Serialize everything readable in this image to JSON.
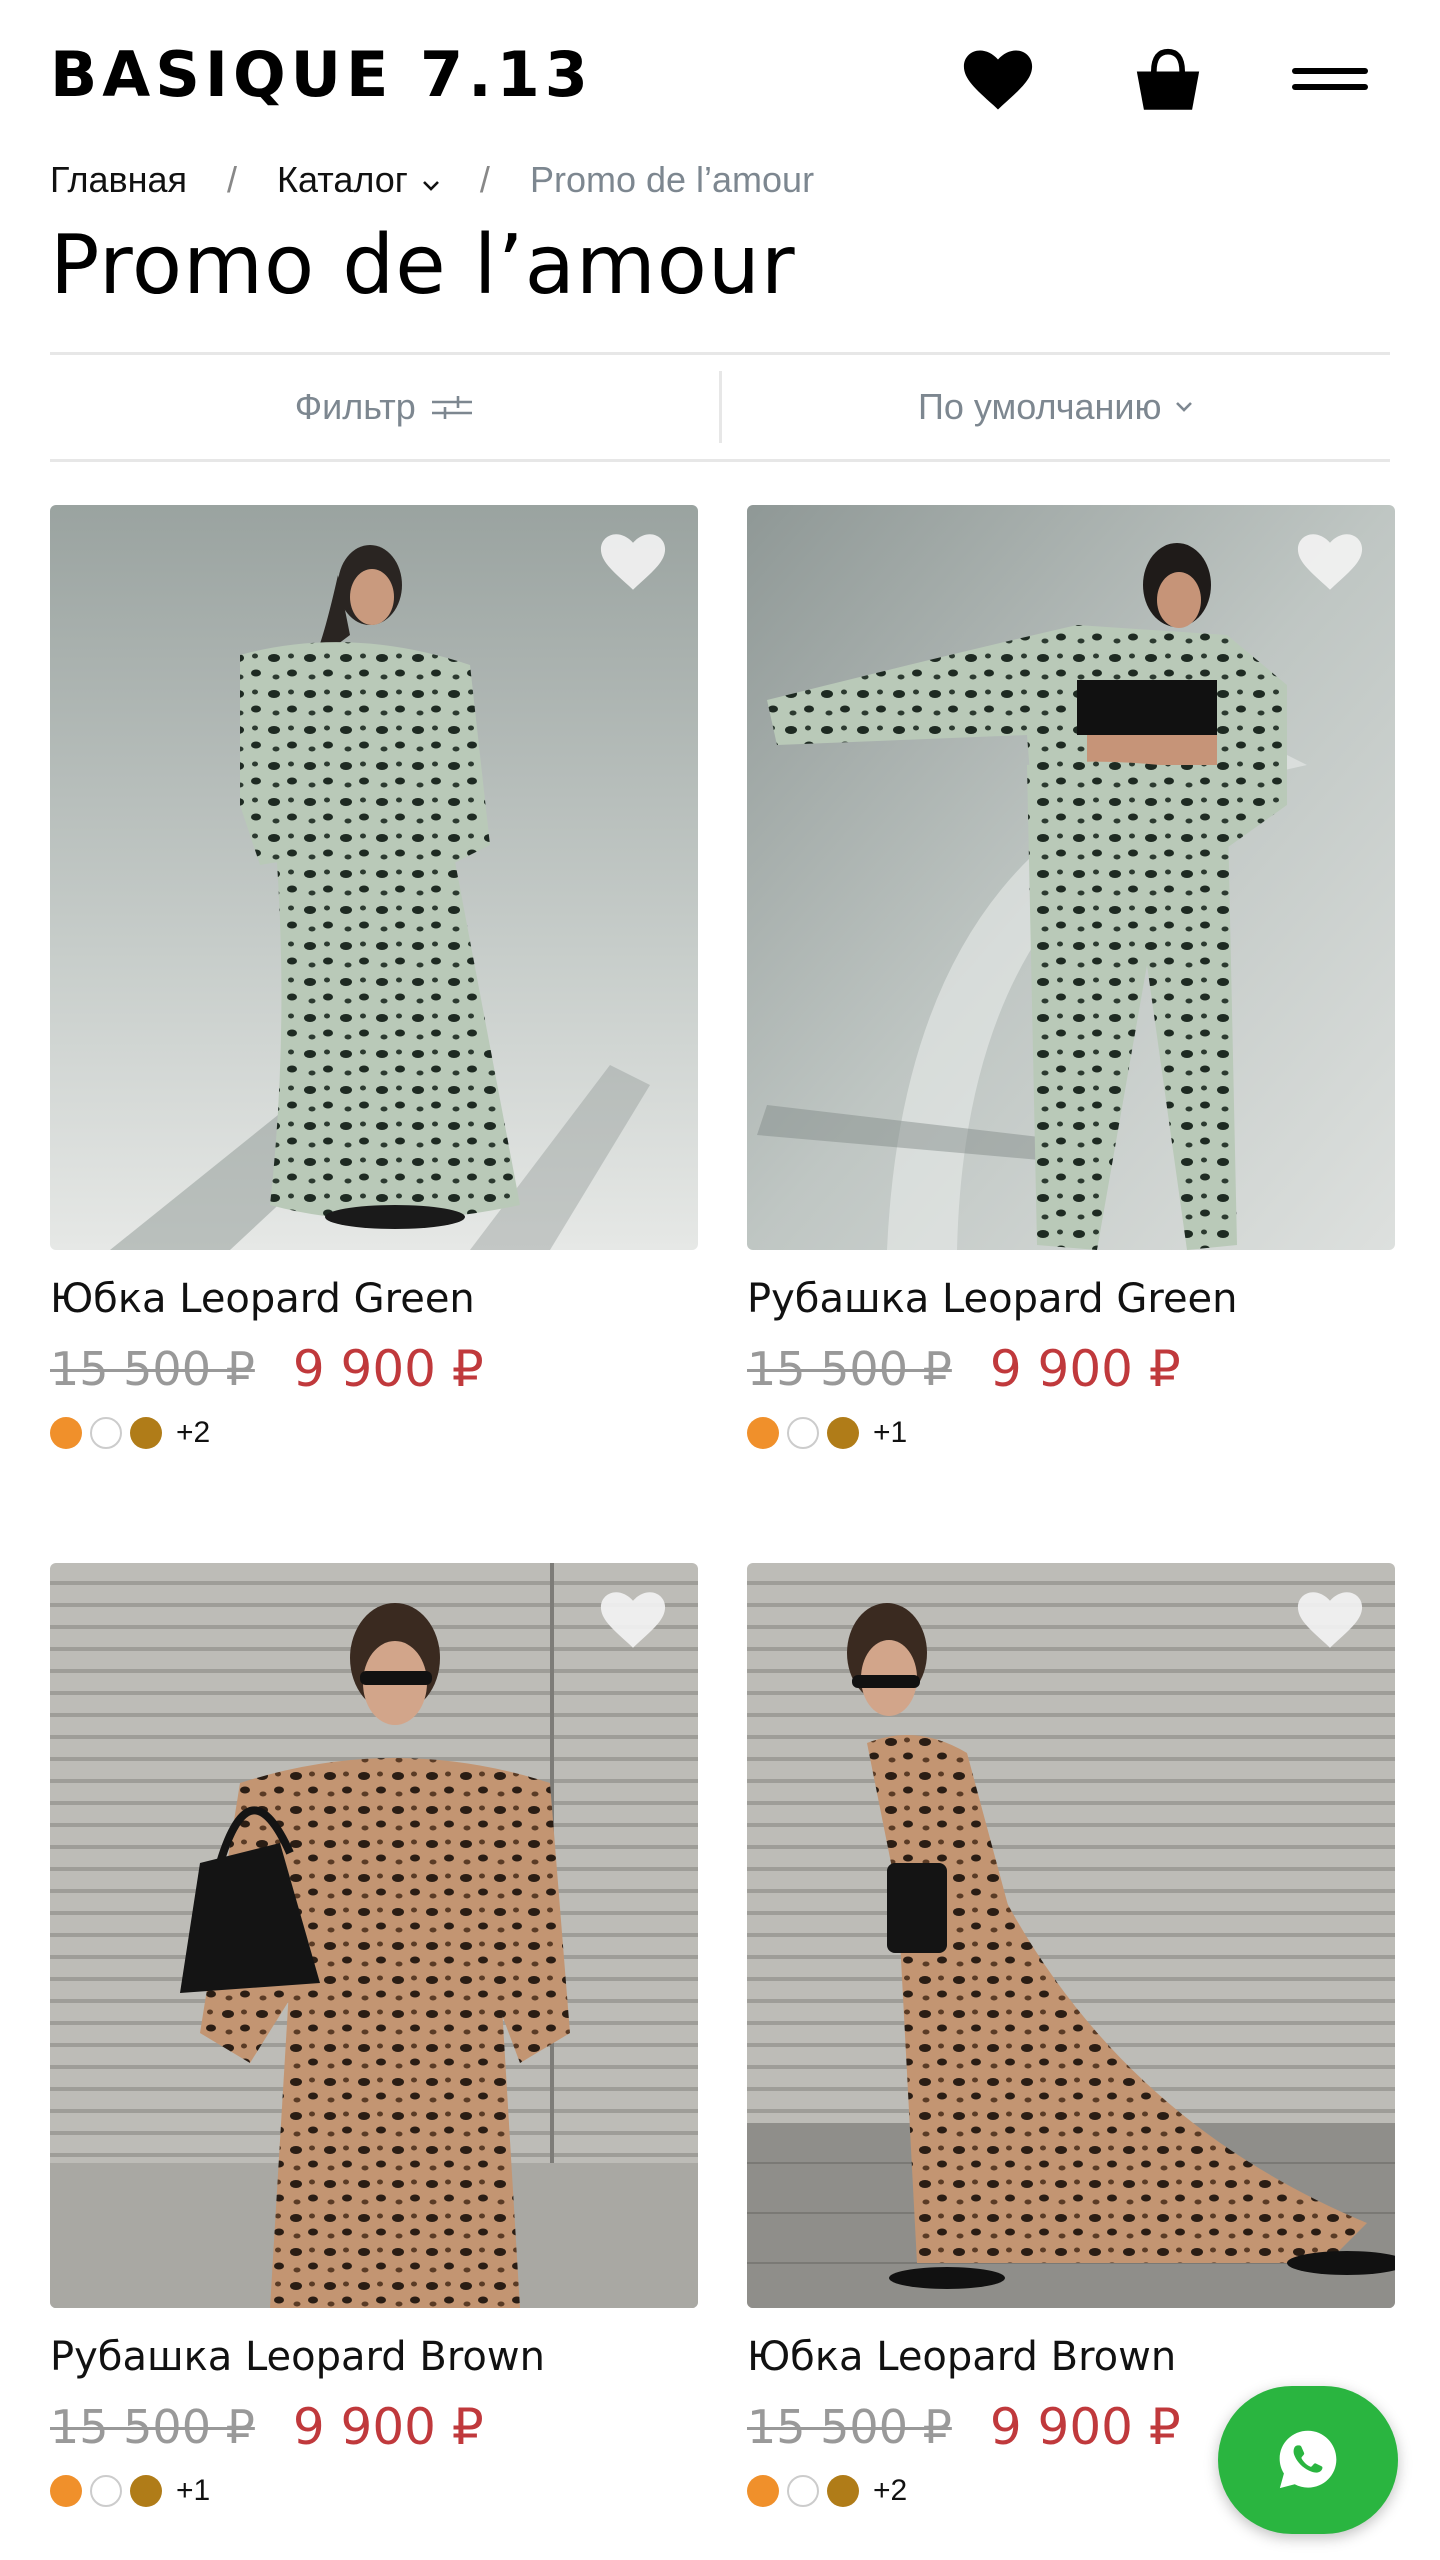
{
  "header": {
    "logo": "BASIQUE 7.13",
    "icons": [
      "heart-icon",
      "bag-icon",
      "menu-icon"
    ]
  },
  "breadcrumb": {
    "home": "Главная",
    "catalog": "Каталог",
    "current": "Promo de l’amour",
    "separator": "/"
  },
  "page": {
    "title": "Promo de l’amour"
  },
  "filter_bar": {
    "filter_label": "Фильтр",
    "sort_label": "По умолчанию"
  },
  "products": [
    {
      "name": "Юбка Leopard Green",
      "old_price": "15 500 ₽",
      "price": "9 900 ₽",
      "swatches": [
        "#f0902b",
        "#ffffff",
        "#b07c18"
      ],
      "more_colors": "+2"
    },
    {
      "name": "Рубашка Leopard Green",
      "old_price": "15 500 ₽",
      "price": "9 900 ₽",
      "swatches": [
        "#f0902b",
        "#ffffff",
        "#b07c18"
      ],
      "more_colors": "+1"
    },
    {
      "name": "Рубашка Leopard Brown",
      "old_price": "15 500 ₽",
      "price": "9 900 ₽",
      "swatches": [
        "#f0902b",
        "#ffffff",
        "#b07c18"
      ],
      "more_colors": "+1"
    },
    {
      "name": "Юбка Leopard Brown",
      "old_price": "15 500 ₽",
      "price": "9 900 ₽",
      "swatches": [
        "#f0902b",
        "#ffffff",
        "#b07c18"
      ],
      "more_colors": "+2"
    }
  ],
  "colors": {
    "sale_price": "#c0393c",
    "old_price": "#999999",
    "whatsapp": "#2ab540",
    "muted_text": "#7d8790"
  }
}
